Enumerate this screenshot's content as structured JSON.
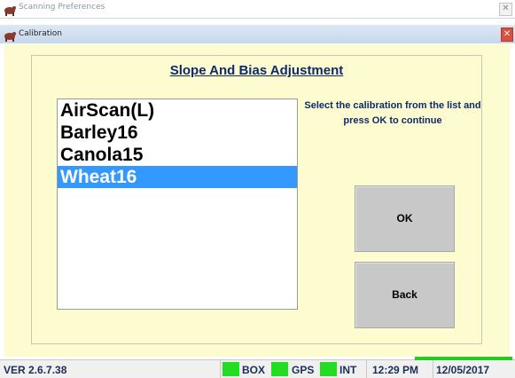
{
  "outer_window": {
    "title": "Scanning Preferences",
    "close_glyph": "✕"
  },
  "dialog": {
    "title": "Calibration",
    "close_glyph": "✕"
  },
  "heading": "Slope And Bias Adjustment",
  "calibration_list": {
    "items": [
      "AirScan(L)",
      "Barley16",
      "Canola15",
      "Wheat16"
    ],
    "selected": "Wheat16"
  },
  "instruction": "Select the calibration from the list and press OK to continue",
  "buttons": {
    "ok": "OK",
    "back": "Back"
  },
  "status_bar": {
    "version": "VER 2.6.7.38",
    "indicators": [
      {
        "label": "BOX",
        "color": "#22dd22"
      },
      {
        "label": "GPS",
        "color": "#22dd22"
      },
      {
        "label": "INT",
        "color": "#22dd22"
      }
    ],
    "time": "12:29 PM",
    "date": "12/05/2017"
  },
  "colors": {
    "client_bg": "#fdfbd0",
    "heading_text": "#0f2a66",
    "selection": "#3399ff",
    "button_bg": "#c8c8c8"
  },
  "icons": {
    "window_icon": "cow-icon"
  }
}
